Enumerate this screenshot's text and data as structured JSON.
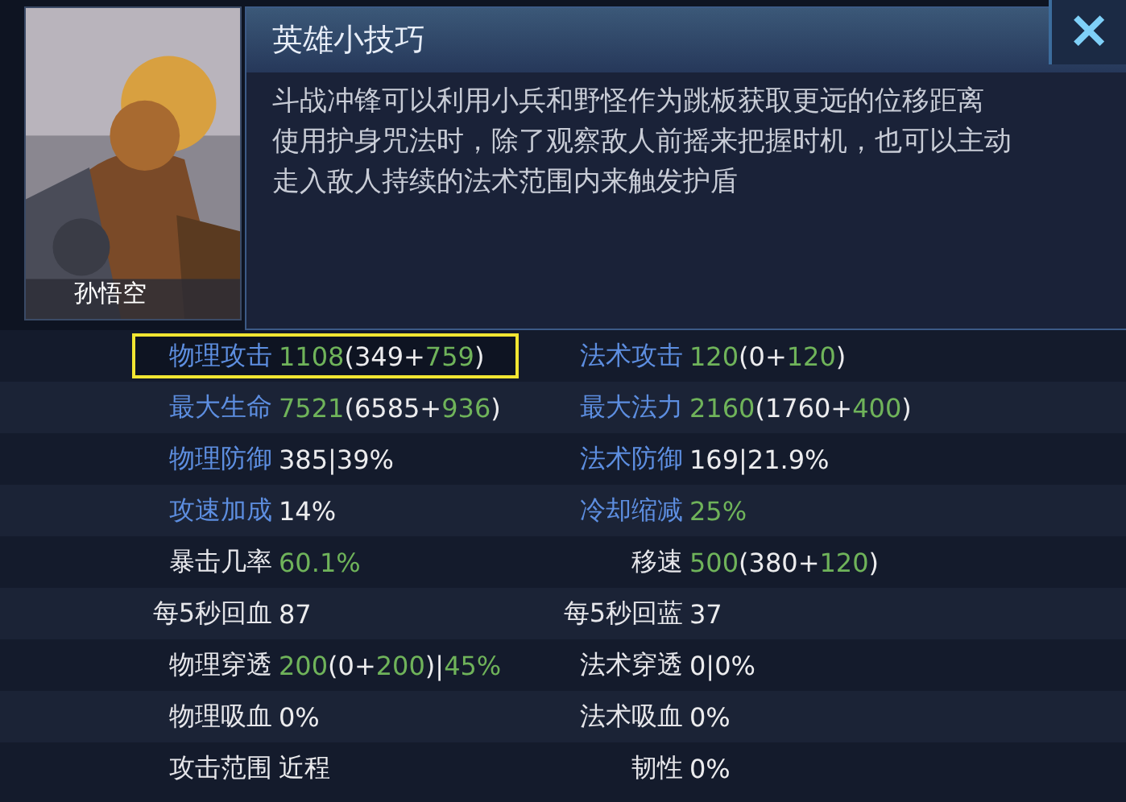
{
  "hero": {
    "name": "孙悟空"
  },
  "tips": {
    "title": "英雄小技巧",
    "lines": [
      "斗战冲锋可以利用小兵和野怪作为跳板获取更远的位移距离",
      "使用护身咒法时，除了观察敌人前摇来把握时机，也可以主动走入敌人持续的法术范围内来触发护盾"
    ]
  },
  "close_button": {
    "label": "✕"
  },
  "stats": [
    [
      {
        "label": "物理攻击",
        "kind": "blue",
        "highlighted": true,
        "value": [
          {
            "text": "1108",
            "green": true
          },
          {
            "text": "(349+",
            "green": false
          },
          {
            "text": "759",
            "green": true
          },
          {
            "text": ")",
            "green": false
          }
        ]
      },
      {
        "label": "法术攻击",
        "kind": "blue",
        "highlighted": false,
        "value": [
          {
            "text": "120",
            "green": true
          },
          {
            "text": "(0+",
            "green": false
          },
          {
            "text": "120",
            "green": true
          },
          {
            "text": ")",
            "green": false
          }
        ]
      }
    ],
    [
      {
        "label": "最大生命",
        "kind": "blue",
        "highlighted": false,
        "value": [
          {
            "text": "7521",
            "green": true
          },
          {
            "text": "(6585+",
            "green": false
          },
          {
            "text": "936",
            "green": true
          },
          {
            "text": ")",
            "green": false
          }
        ]
      },
      {
        "label": "最大法力",
        "kind": "blue",
        "highlighted": false,
        "value": [
          {
            "text": "2160",
            "green": true
          },
          {
            "text": "(1760+",
            "green": false
          },
          {
            "text": "400",
            "green": true
          },
          {
            "text": ")",
            "green": false
          }
        ]
      }
    ],
    [
      {
        "label": "物理防御",
        "kind": "blue",
        "highlighted": false,
        "value": [
          {
            "text": "385|39%",
            "green": false
          }
        ]
      },
      {
        "label": "法术防御",
        "kind": "blue",
        "highlighted": false,
        "value": [
          {
            "text": "169|21.9%",
            "green": false
          }
        ]
      }
    ],
    [
      {
        "label": "攻速加成",
        "kind": "blue",
        "highlighted": false,
        "value": [
          {
            "text": "14%",
            "green": false
          }
        ]
      },
      {
        "label": "冷却缩减",
        "kind": "blue",
        "highlighted": false,
        "value": [
          {
            "text": "25%",
            "green": true
          }
        ]
      }
    ],
    [
      {
        "label": "暴击几率",
        "kind": "white",
        "highlighted": false,
        "value": [
          {
            "text": "60.1%",
            "green": true
          }
        ]
      },
      {
        "label": "移速",
        "kind": "white",
        "highlighted": false,
        "value": [
          {
            "text": "500",
            "green": true
          },
          {
            "text": "(380+",
            "green": false
          },
          {
            "text": "120",
            "green": true
          },
          {
            "text": ")",
            "green": false
          }
        ]
      }
    ],
    [
      {
        "label": "每5秒回血",
        "kind": "white",
        "highlighted": false,
        "value": [
          {
            "text": "87",
            "green": false
          }
        ]
      },
      {
        "label": "每5秒回蓝",
        "kind": "white",
        "highlighted": false,
        "value": [
          {
            "text": "37",
            "green": false
          }
        ]
      }
    ],
    [
      {
        "label": "物理穿透",
        "kind": "white",
        "highlighted": false,
        "value": [
          {
            "text": "200",
            "green": true
          },
          {
            "text": "(0+",
            "green": false
          },
          {
            "text": "200",
            "green": true
          },
          {
            "text": ")|",
            "green": false
          },
          {
            "text": "45%",
            "green": true
          }
        ]
      },
      {
        "label": "法术穿透",
        "kind": "white",
        "highlighted": false,
        "value": [
          {
            "text": "0|0%",
            "green": false
          }
        ]
      }
    ],
    [
      {
        "label": "物理吸血",
        "kind": "white",
        "highlighted": false,
        "value": [
          {
            "text": "0%",
            "green": false
          }
        ]
      },
      {
        "label": "法术吸血",
        "kind": "white",
        "highlighted": false,
        "value": [
          {
            "text": "0%",
            "green": false
          }
        ]
      }
    ],
    [
      {
        "label": "攻击范围",
        "kind": "white",
        "highlighted": false,
        "value": [
          {
            "text": "近程",
            "green": false
          }
        ]
      },
      {
        "label": "韧性",
        "kind": "white",
        "highlighted": false,
        "value": [
          {
            "text": "0%",
            "green": false
          }
        ]
      }
    ]
  ]
}
